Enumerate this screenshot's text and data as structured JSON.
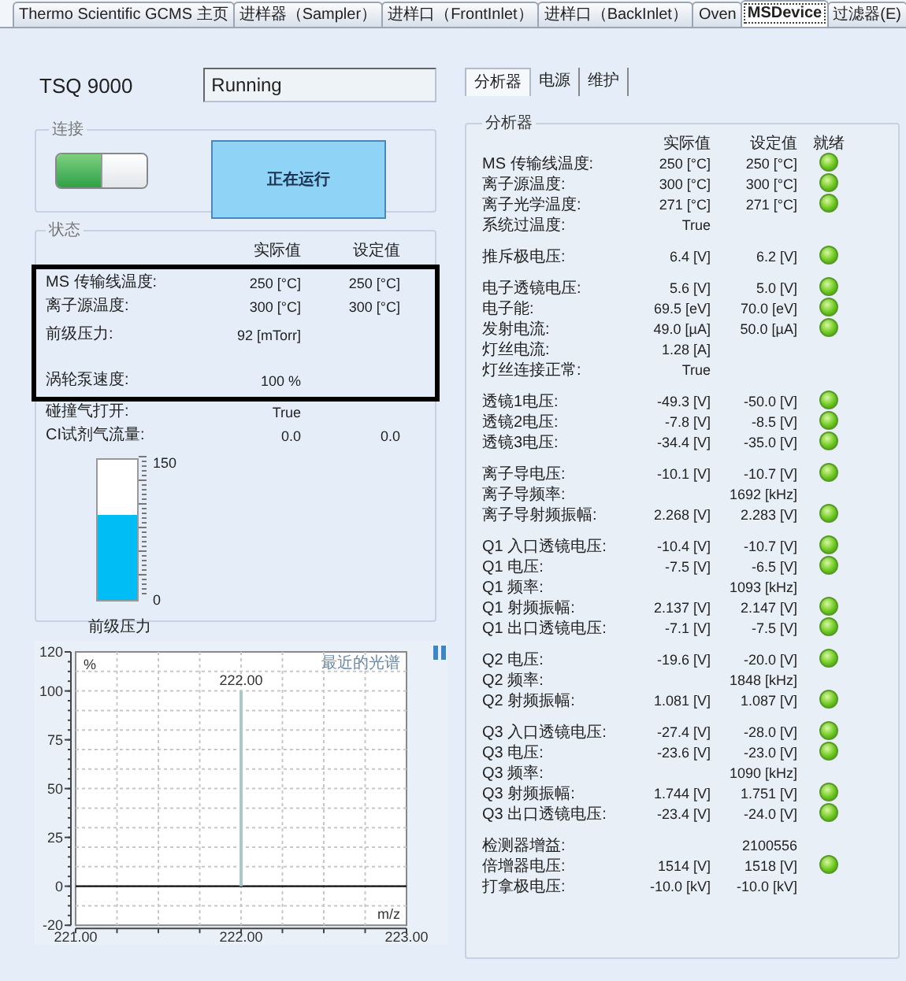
{
  "tabs": [
    {
      "label": "Thermo Scientific GCMS 主页",
      "selected": false
    },
    {
      "label": "进样器（Sampler）",
      "selected": false
    },
    {
      "label": "进样口（FrontInlet）",
      "selected": false
    },
    {
      "label": "进样口（BackInlet）",
      "selected": false
    },
    {
      "label": "Oven",
      "selected": false
    },
    {
      "label": "MSDevice",
      "selected": true
    },
    {
      "label": "过滤器(E)",
      "selected": false
    }
  ],
  "device": {
    "name": "TSQ 9000",
    "status": "Running"
  },
  "connection": {
    "title": "连接",
    "on": true,
    "state_button": "正在运行"
  },
  "status": {
    "title": "状态",
    "columns": [
      "实际值",
      "设定值"
    ],
    "sections": [
      {
        "highlighted": true,
        "rows": [
          {
            "label": "MS 传输线温度:",
            "actual": "250 [°C]",
            "setpoint": "250 [°C]"
          },
          {
            "label": "离子源温度:",
            "actual": "300 [°C]",
            "setpoint": "300 [°C]"
          },
          {
            "label": "前级压力:",
            "actual": "92 [mTorr]"
          },
          {
            "label": "涡轮泵速度:",
            "actual": "100 %"
          }
        ]
      },
      {
        "highlighted": false,
        "rows": [
          {
            "label": "碰撞气打开:",
            "actual": "True"
          },
          {
            "label": "CI试剂气流量:",
            "actual": "0.0",
            "setpoint": "0.0"
          }
        ]
      }
    ],
    "gauge": {
      "label": "前级压力",
      "max": "150",
      "min": "0",
      "level": 0.61
    }
  },
  "spectrum": {
    "chart_data": {
      "type": "bar",
      "grid": true,
      "title": "最近的光谱",
      "xlabel": "m/z",
      "ylabel": "%",
      "x": [
        222.0
      ],
      "values": [
        100
      ],
      "xlim": [
        221,
        223
      ],
      "ylim": [
        -20,
        120
      ],
      "xticks": [
        {
          "value": 221,
          "label": "221.00"
        },
        {
          "value": 222,
          "label": "222.00"
        },
        {
          "value": 223,
          "label": "223.00"
        }
      ],
      "yticks": [
        -20,
        0,
        25,
        50,
        75,
        100,
        120
      ],
      "annotations": [
        {
          "x": 222,
          "y": 100,
          "text": "222.00"
        }
      ]
    }
  },
  "sub_tabs": [
    {
      "label": "分析器",
      "selected": true
    },
    {
      "label": "电源",
      "selected": false
    },
    {
      "label": "维护",
      "selected": false
    }
  ],
  "analyzer": {
    "title": "分析器",
    "columns": [
      "实际值",
      "设定值",
      "就绪"
    ],
    "groups": [
      {
        "rows": [
          {
            "label": "MS 传输线温度:",
            "actual": "250 [°C]",
            "setpoint": "250 [°C]",
            "ready": true
          },
          {
            "label": "离子源温度:",
            "actual": "300 [°C]",
            "setpoint": "300 [°C]",
            "ready": true
          },
          {
            "label": "离子光学温度:",
            "actual": "271 [°C]",
            "setpoint": "271 [°C]",
            "ready": true
          },
          {
            "label": "系统过温度:",
            "actual": "True",
            "ready": false
          }
        ]
      },
      {
        "rows": [
          {
            "label": "推斥极电压:",
            "actual": "6.4 [V]",
            "setpoint": "6.2 [V]",
            "ready": true
          }
        ]
      },
      {
        "rows": [
          {
            "label": "电子透镜电压:",
            "actual": "5.6 [V]",
            "setpoint": "5.0 [V]",
            "ready": true
          },
          {
            "label": "电子能:",
            "actual": "69.5 [eV]",
            "setpoint": "70.0 [eV]",
            "ready": true
          },
          {
            "label": "发射电流:",
            "actual": "49.0 [µA]",
            "setpoint": "50.0 [µA]",
            "ready": true
          },
          {
            "label": "灯丝电流:",
            "actual": "1.28 [A]",
            "ready": false
          },
          {
            "label": "灯丝连接正常:",
            "actual": "True",
            "ready": false
          }
        ]
      },
      {
        "rows": [
          {
            "label": "透镜1电压:",
            "actual": "-49.3 [V]",
            "setpoint": "-50.0 [V]",
            "ready": true
          },
          {
            "label": "透镜2电压:",
            "actual": "-7.8 [V]",
            "setpoint": "-8.5 [V]",
            "ready": true
          },
          {
            "label": "透镜3电压:",
            "actual": "-34.4 [V]",
            "setpoint": "-35.0 [V]",
            "ready": true
          }
        ]
      },
      {
        "rows": [
          {
            "label": "离子导电压:",
            "actual": "-10.1 [V]",
            "setpoint": "-10.7 [V]",
            "ready": true
          },
          {
            "label": "离子导频率:",
            "setpoint": "1692 [kHz]",
            "ready": false
          },
          {
            "label": "离子导射频振幅:",
            "actual": "2.268 [V]",
            "setpoint": "2.283 [V]",
            "ready": true
          }
        ]
      },
      {
        "rows": [
          {
            "label": "Q1 入口透镜电压:",
            "actual": "-10.4 [V]",
            "setpoint": "-10.7 [V]",
            "ready": true
          },
          {
            "label": "Q1 电压:",
            "actual": "-7.5 [V]",
            "setpoint": "-6.5 [V]",
            "ready": true
          },
          {
            "label": "Q1 频率:",
            "setpoint": "1093 [kHz]",
            "ready": false
          },
          {
            "label": "Q1 射频振幅:",
            "actual": "2.137 [V]",
            "setpoint": "2.147 [V]",
            "ready": true
          },
          {
            "label": "Q1 出口透镜电压:",
            "actual": "-7.1 [V]",
            "setpoint": "-7.5 [V]",
            "ready": true
          }
        ]
      },
      {
        "rows": [
          {
            "label": "Q2 电压:",
            "actual": "-19.6 [V]",
            "setpoint": "-20.0 [V]",
            "ready": true
          },
          {
            "label": "Q2 频率:",
            "setpoint": "1848 [kHz]",
            "ready": false
          },
          {
            "label": "Q2 射频振幅:",
            "actual": "1.081 [V]",
            "setpoint": "1.087 [V]",
            "ready": true
          }
        ]
      },
      {
        "rows": [
          {
            "label": "Q3 入口透镜电压:",
            "actual": "-27.4 [V]",
            "setpoint": "-28.0 [V]",
            "ready": true
          },
          {
            "label": "Q3 电压:",
            "actual": "-23.6 [V]",
            "setpoint": "-23.0 [V]",
            "ready": true
          },
          {
            "label": "Q3 频率:",
            "setpoint": "1090 [kHz]",
            "ready": false
          },
          {
            "label": "Q3 射频振幅:",
            "actual": "1.744 [V]",
            "setpoint": "1.751 [V]",
            "ready": true
          },
          {
            "label": "Q3 出口透镜电压:",
            "actual": "-23.4 [V]",
            "setpoint": "-24.0 [V]",
            "ready": true
          }
        ]
      },
      {
        "rows": [
          {
            "label": "检测器增益:",
            "setpoint": "2100556",
            "ready": false
          },
          {
            "label": "倍增器电压:",
            "actual": "1514 [V]",
            "setpoint": "1518 [V]",
            "ready": true
          },
          {
            "label": "打拿极电压:",
            "actual": "-10.0 [kV]",
            "setpoint": "-10.0 [kV]",
            "ready": false
          }
        ]
      }
    ]
  }
}
